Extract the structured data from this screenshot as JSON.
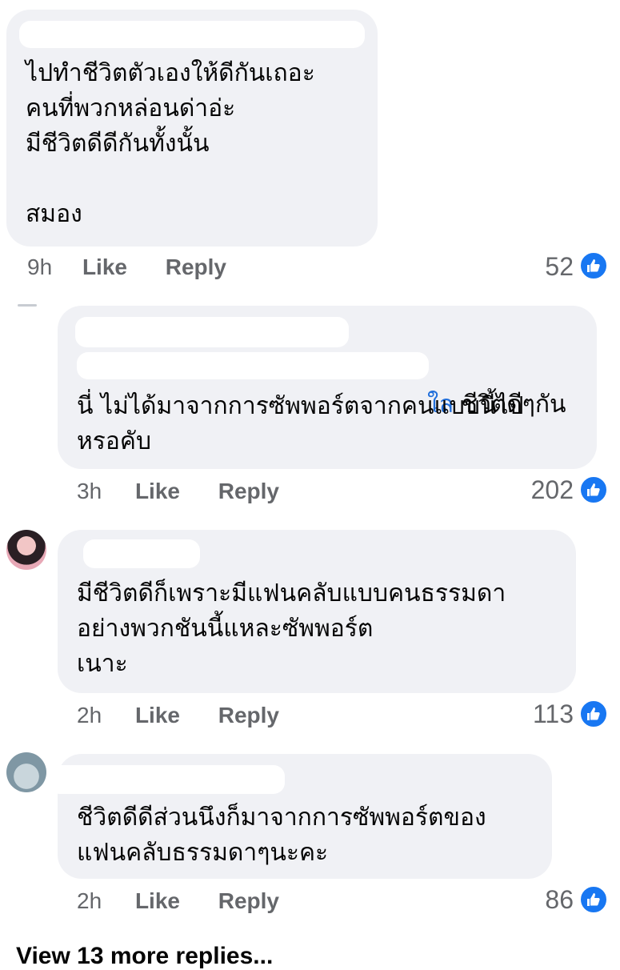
{
  "comments": [
    {
      "text": "ไปทำชีวิตตัวเองให้ดีกันเถอะ\nคนที่พวกหล่อนด่าอ่ะ\nมีชีวิตดีดีกันทั้งนั้น\n\nสมอง",
      "time": "9h",
      "like_label": "Like",
      "reply_label": "Reply",
      "reactions": "52"
    },
    {
      "mention_tail": "ใล",
      "text_line1": " ชีวิตดีๆกัน",
      "text_rest": "นี่ ไม่ได้มาจากการซัพพอร์ตจากคนแบบนี้ไป\nหรอคับ",
      "time": "3h",
      "like_label": "Like",
      "reply_label": "Reply",
      "reactions": "202"
    },
    {
      "text": "มีชีวิตดีก็เพราะมีแฟนคลับแบบคนธรรมดา\nอย่างพวกชันนี้แหละซัพพอร์ต\nเนาะ",
      "time": "2h",
      "like_label": "Like",
      "reply_label": "Reply",
      "reactions": "113"
    },
    {
      "text": "ชีวิตดีดีส่วนนึงก็มาจากการซัพพอร์ตของ\nแฟนคลับธรรมดาๆนะคะ",
      "time": "2h",
      "like_label": "Like",
      "reply_label": "Reply",
      "reactions": "86"
    }
  ],
  "view_more": "View 13 more replies...",
  "colors": {
    "bubble": "#f0f1f5",
    "meta": "#65676b",
    "like_blue": "#1877f2",
    "mention": "#216fdb"
  },
  "icons": {
    "reaction": "thumbs-up-icon"
  }
}
